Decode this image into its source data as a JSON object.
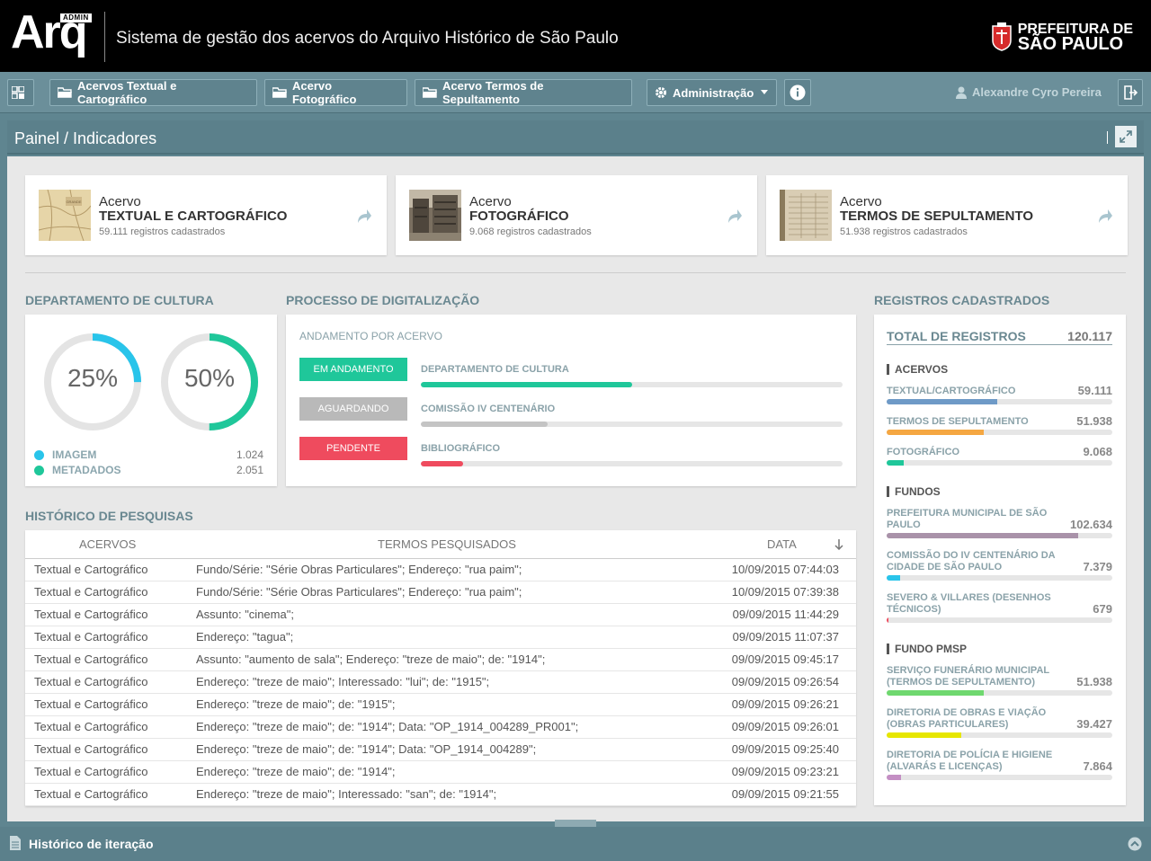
{
  "header": {
    "logo_badge": "ADMIN",
    "logo": "Arq",
    "system_title": "Sistema de gestão dos acervos do Arquivo Histórico de São Paulo",
    "prefeitura_line1": "PREFEITURA DE",
    "prefeitura_line2": "SÃO PAULO"
  },
  "nav": {
    "grid_icon": "grid-icon",
    "buttons": [
      {
        "label": "Acervos Textual e Cartográfico",
        "icon": "folder-icon"
      },
      {
        "label": "Acervo Fotográfico",
        "icon": "folder-icon"
      },
      {
        "label": "Acervo Termos de Sepultamento",
        "icon": "folder-icon"
      },
      {
        "label": "Administração",
        "icon": "gear-icon"
      }
    ],
    "info_icon": "info-icon",
    "user_name": "Alexandre Cyro Pereira",
    "logout_icon": "logout-icon"
  },
  "panel": {
    "title": "Painel / Indicadores"
  },
  "cards": [
    {
      "line1": "Acervo",
      "line2": "TEXTUAL E CARTOGRÁFICO",
      "count": "59.111 registros cadastrados"
    },
    {
      "line1": "Acervo",
      "line2": "FOTOGRÁFICO",
      "count": "9.068 registros cadastrados"
    },
    {
      "line1": "Acervo",
      "line2": "TERMOS DE SEPULTAMENTO",
      "count": "51.938 registros cadastrados"
    }
  ],
  "cultura": {
    "title": "DEPARTAMENTO DE CULTURA",
    "donuts": [
      {
        "pct_label": "25%",
        "fraction": 0.25,
        "color": "#29c4ea"
      },
      {
        "pct_label": "50%",
        "fraction": 0.5,
        "color": "#1fc79a"
      }
    ],
    "legend": [
      {
        "label": "IMAGEM",
        "value": "1.024",
        "color": "#29c4ea"
      },
      {
        "label": "METADADOS",
        "value": "2.051",
        "color": "#1fc79a"
      }
    ]
  },
  "digitalizacao": {
    "title": "PROCESSO DE DIGITALIZAÇÃO",
    "subtitle": "ANDAMENTO POR ACERVO",
    "rows": [
      {
        "status": "EM ANDAMENTO",
        "status_color": "#1fc79a",
        "label": "DEPARTAMENTO DE CULTURA",
        "fraction": 0.5,
        "bar_color": "#1fc79a"
      },
      {
        "status": "AGUARDANDO",
        "status_color": "#b9b9b9",
        "label": "COMISSÃO IV CENTENÁRIO",
        "fraction": 0.3,
        "bar_color": "#c4c4c4"
      },
      {
        "status": "PENDENTE",
        "status_color": "#ef4b5e",
        "label": "BIBLIOGRÁFICO",
        "fraction": 0.1,
        "bar_color": "#ef4b5e"
      }
    ]
  },
  "registros": {
    "title": "REGISTROS CADASTRADOS",
    "total_label": "TOTAL DE REGISTROS",
    "total_value": "120.117",
    "groups": [
      {
        "name": "ACERVOS",
        "items": [
          {
            "label": "TEXTUAL/CARTOGRÁFICO",
            "value": "59.111",
            "fraction": 0.49,
            "color": "#6e9ac7"
          },
          {
            "label": "TERMOS DE SEPULTAMENTO",
            "value": "51.938",
            "fraction": 0.43,
            "color": "#f5a742"
          },
          {
            "label": "FOTOGRÁFICO",
            "value": "9.068",
            "fraction": 0.075,
            "color": "#1fc79a"
          }
        ]
      },
      {
        "name": "FUNDOS",
        "items": [
          {
            "label": "PREFEITURA MUNICIPAL DE SÃO PAULO",
            "value": "102.634",
            "fraction": 0.85,
            "color": "#a992a9"
          },
          {
            "label": "COMISSÃO DO IV CENTENÁRIO DA CIDADE DE SÃO PAULO",
            "value": "7.379",
            "fraction": 0.06,
            "color": "#29c4ea"
          },
          {
            "label": "SEVERO & VILLARES (DESENHOS TÉCNICOS)",
            "value": "679",
            "fraction": 0.006,
            "color": "#ef4b5e"
          }
        ]
      },
      {
        "name": "FUNDO PMSP",
        "items": [
          {
            "label": "SERVIÇO FUNERÁRIO MUNICIPAL (TERMOS DE SEPULTAMENTO)",
            "value": "51.938",
            "fraction": 0.43,
            "color": "#6fd86f"
          },
          {
            "label": "DIRETORIA DE OBRAS E VIAÇÃO (OBRAS PARTICULARES)",
            "value": "39.427",
            "fraction": 0.33,
            "color": "#e6e600"
          },
          {
            "label": "DIRETORIA DE POLÍCIA E HIGIENE (ALVARÁS E LICENÇAS)",
            "value": "7.864",
            "fraction": 0.065,
            "color": "#c48fc4"
          }
        ]
      }
    ]
  },
  "historico": {
    "title": "HISTÓRICO DE PESQUISAS",
    "col_acervos": "ACERVOS",
    "col_termos": "TERMOS PESQUISADOS",
    "col_data": "DATA",
    "rows": [
      {
        "acervo": "Textual e Cartográfico",
        "termos": "Fundo/Série: \"Série Obras Particulares\"; Endereço: \"rua paim\";",
        "data": "10/09/2015 07:44:03"
      },
      {
        "acervo": "Textual e Cartográfico",
        "termos": "Fundo/Série: \"Série Obras Particulares\"; Endereço: \"rua paim\";",
        "data": "10/09/2015 07:39:38"
      },
      {
        "acervo": "Textual e Cartográfico",
        "termos": "Assunto: \"cinema\";",
        "data": "09/09/2015 11:44:29"
      },
      {
        "acervo": "Textual e Cartográfico",
        "termos": "Endereço: \"tagua\";",
        "data": "09/09/2015 11:07:37"
      },
      {
        "acervo": "Textual e Cartográfico",
        "termos": "Assunto: \"aumento de sala\"; Endereço: \"treze de maio\"; de: \"1914\";",
        "data": "09/09/2015 09:45:17"
      },
      {
        "acervo": "Textual e Cartográfico",
        "termos": "Endereço: \"treze de maio\"; Interessado: \"lui\"; de: \"1915\";",
        "data": "09/09/2015 09:26:54"
      },
      {
        "acervo": "Textual e Cartográfico",
        "termos": "Endereço: \"treze de maio\"; de: \"1915\";",
        "data": "09/09/2015 09:26:21"
      },
      {
        "acervo": "Textual e Cartográfico",
        "termos": "Endereço: \"treze de maio\"; de: \"1914\"; Data: \"OP_1914_004289_PR001\";",
        "data": "09/09/2015 09:26:01"
      },
      {
        "acervo": "Textual e Cartográfico",
        "termos": "Endereço: \"treze de maio\"; de: \"1914\"; Data: \"OP_1914_004289\";",
        "data": "09/09/2015 09:25:40"
      },
      {
        "acervo": "Textual e Cartográfico",
        "termos": "Endereço: \"treze de maio\"; de: \"1914\";",
        "data": "09/09/2015 09:23:21"
      },
      {
        "acervo": "Textual e Cartográfico",
        "termos": "Endereço: \"treze de maio\"; Interessado: \"san\"; de: \"1914\";",
        "data": "09/09/2015 09:21:55"
      }
    ]
  },
  "footer": {
    "title": "Histórico de iteração"
  }
}
